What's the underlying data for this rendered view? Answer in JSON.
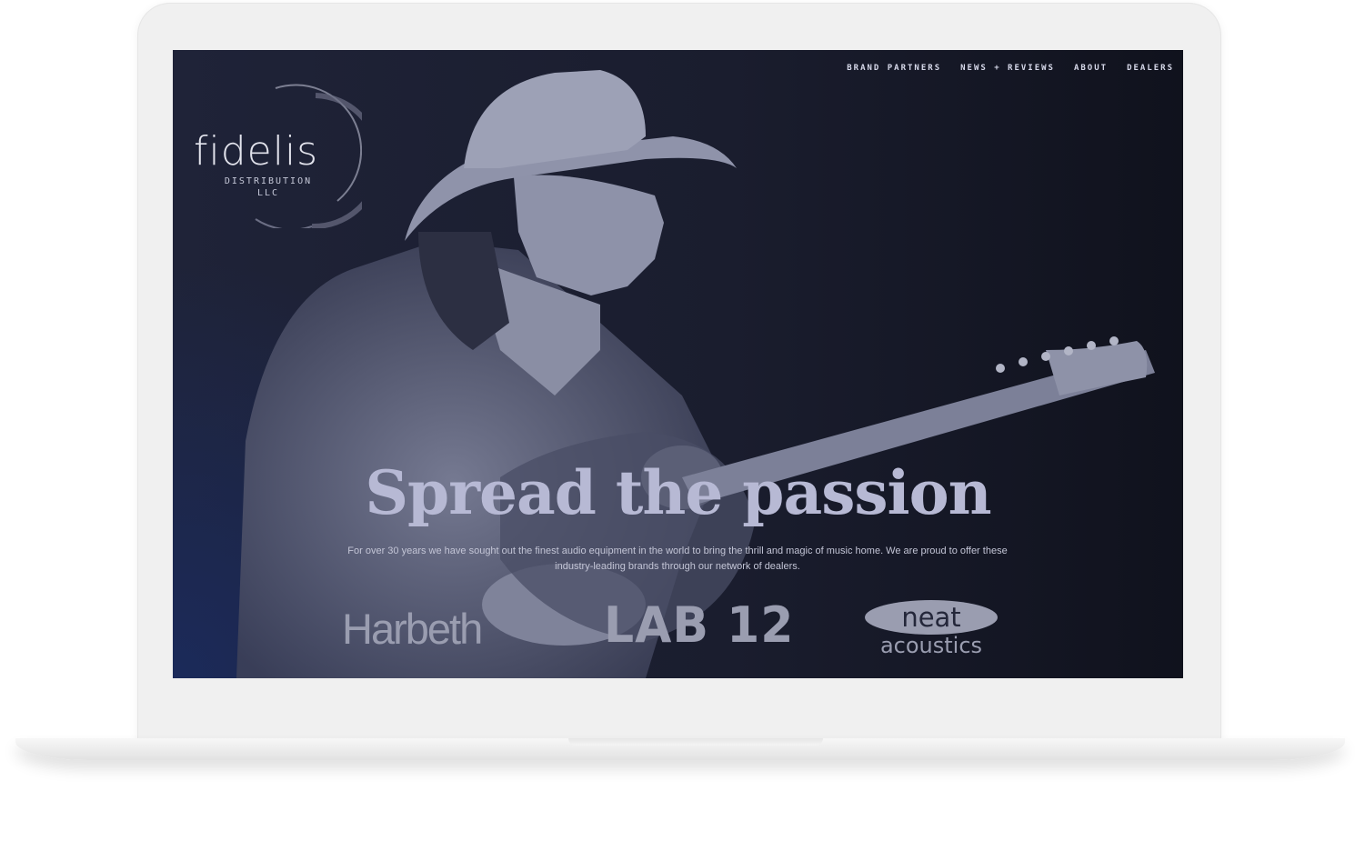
{
  "nav": {
    "items": [
      {
        "label": "BRAND PARTNERS"
      },
      {
        "label": "NEWS + REVIEWS"
      },
      {
        "label": "ABOUT"
      },
      {
        "label": "DEALERS"
      }
    ]
  },
  "logo": {
    "word": "fidelis",
    "sub_line1": "DISTRIBUTION",
    "sub_line2": "LLC"
  },
  "hero": {
    "headline": "Spread the passion",
    "lead": "For over 30 years we have sought out the finest audio equipment in the world to bring the thrill and magic of music home. We are proud to offer these industry-leading brands through our network of dealers."
  },
  "brands": {
    "harbeth": "Harbeth",
    "lab12": "LAB 12",
    "neat_word": "neat",
    "neat_sub": "acoustics"
  }
}
